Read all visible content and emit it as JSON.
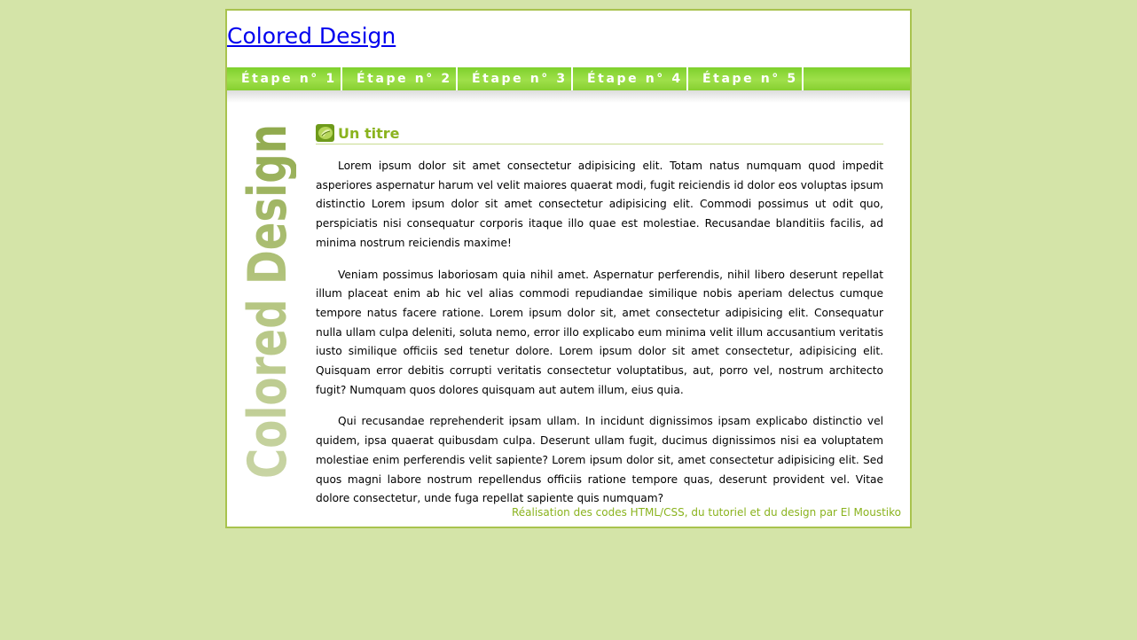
{
  "site": {
    "title": "Colored Design"
  },
  "nav": {
    "items": [
      {
        "label": "Étape n° 1"
      },
      {
        "label": "Étape n° 2"
      },
      {
        "label": "Étape n° 3"
      },
      {
        "label": "Étape n° 4"
      },
      {
        "label": "Étape n° 5"
      }
    ]
  },
  "sidebar": {
    "logo_text": "Colored Design"
  },
  "main": {
    "title": "Un titre",
    "title_icon": "leaf-icon",
    "paragraphs": [
      "Lorem ipsum dolor sit amet consectetur adipisicing elit. Totam natus numquam quod impedit asperiores aspernatur harum vel velit maiores quaerat modi, fugit reiciendis id dolor eos voluptas ipsum distinctio Lorem ipsum dolor sit amet consectetur adipisicing elit. Commodi possimus ut odit quo, perspiciatis nisi consequatur corporis itaque illo quae est molestiae. Recusandae blanditiis facilis, ad minima nostrum reiciendis maxime!",
      "Veniam possimus laboriosam quia nihil amet. Aspernatur perferendis, nihil libero deserunt repellat illum placeat enim ab hic vel alias commodi repudiandae similique nobis aperiam delectus cumque tempore natus facere ratione. Lorem ipsum dolor sit, amet consectetur adipisicing elit. Consequatur nulla ullam culpa deleniti, soluta nemo, error illo explicabo eum minima velit illum accusantium veritatis iusto similique officiis sed tenetur dolore. Lorem ipsum dolor sit amet consectetur, adipisicing elit. Quisquam error debitis corrupti veritatis consectetur voluptatibus, aut, porro vel, nostrum architecto fugit? Numquam quos dolores quisquam aut autem illum, eius quia.",
      "Qui recusandae reprehenderit ipsam ullam. In incidunt dignissimos ipsam explicabo distinctio vel quidem, ipsa quaerat quibusdam culpa. Deserunt ullam fugit, ducimus dignissimos nisi ea voluptatem molestiae enim perferendis velit sapiente? Lorem ipsum dolor sit, amet consectetur adipisicing elit. Sed quos magni labore nostrum repellendus officiis ratione tempore quas, deserunt provident vel. Vitae dolore consectetur, unde fuga repellat sapiente quis numquam?"
    ]
  },
  "footer": {
    "text": "Réalisation des codes HTML/CSS, du tutoriel et du design par El Moustiko"
  },
  "colors": {
    "background": "#d4e4a8",
    "border": "#a8c34e",
    "nav": "#8fd63a",
    "accent": "#8ab31e",
    "link": "#0000ee"
  }
}
